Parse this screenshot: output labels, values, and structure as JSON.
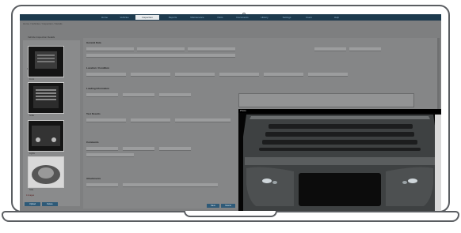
{
  "app": {
    "breadcrumb": "Home / Vehicles / Inspection / Details",
    "subtitle": "Vehicle Inspection Details"
  },
  "tabs": [
    {
      "label": "Home"
    },
    {
      "label": "Vehicles"
    },
    {
      "label": "Inspection"
    },
    {
      "label": "Reports"
    },
    {
      "label": "Maintenance"
    },
    {
      "label": "Parts"
    },
    {
      "label": "Documents"
    },
    {
      "label": "History"
    },
    {
      "label": "Settings"
    },
    {
      "label": "Users"
    },
    {
      "label": "Help"
    }
  ],
  "left_panel": {
    "heading": "Images",
    "thumbs": [
      {
        "label": "Front"
      },
      {
        "label": "Grille"
      },
      {
        "label": "Lights"
      },
      {
        "label": "Side"
      }
    ],
    "status": "4 images",
    "buttons": [
      "Upload",
      "Delete"
    ]
  },
  "main": {
    "sections": [
      "General Data",
      "Location / Condition",
      "Loading Information",
      "Test Results",
      "Comments",
      "Attachments"
    ],
    "footer_buttons": [
      "Save",
      "Cancel"
    ]
  },
  "overlay": {
    "title": "Photo"
  },
  "colors": {
    "topbar": "#1d3a4e",
    "active_tab": "#e7eaec",
    "dim_overlay": "#808080"
  }
}
